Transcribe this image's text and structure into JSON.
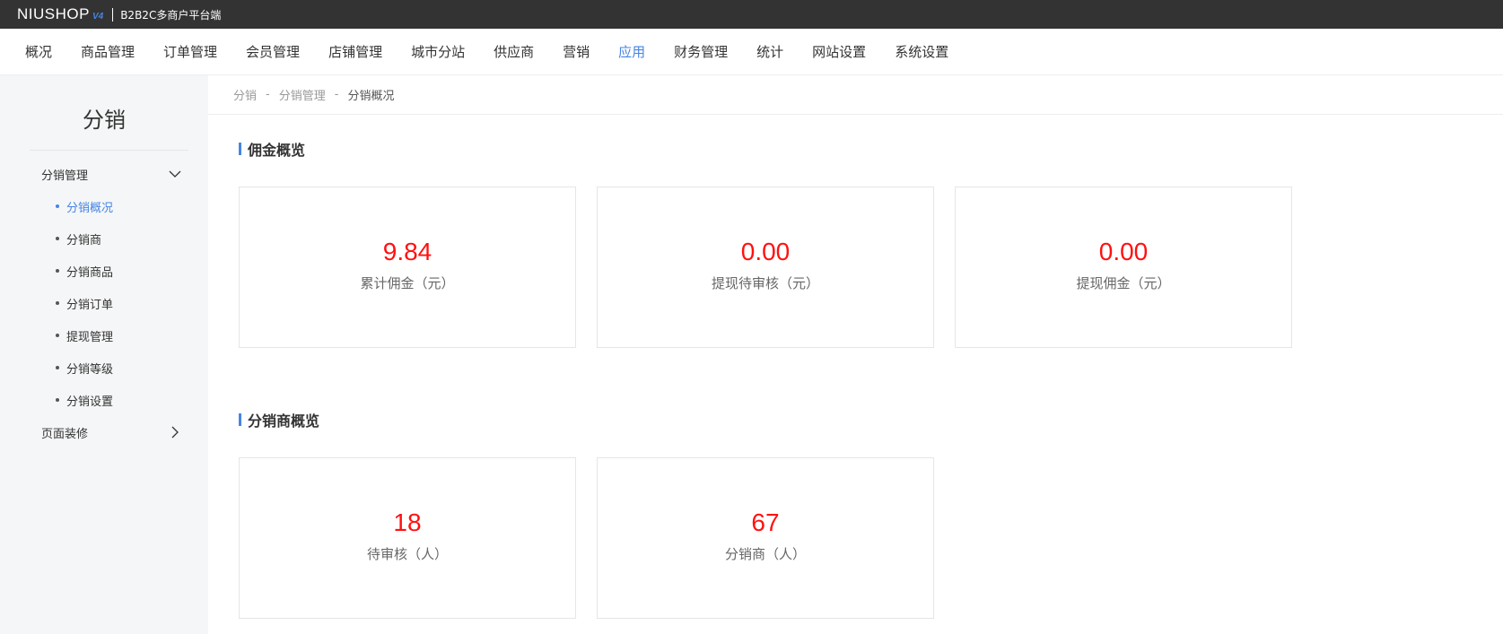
{
  "topbar": {
    "logo_text": "NIUSHOP",
    "logo_version": "V4",
    "platform_label": "B2B2C多商户平台端"
  },
  "nav": {
    "items": [
      {
        "label": "概况"
      },
      {
        "label": "商品管理"
      },
      {
        "label": "订单管理"
      },
      {
        "label": "会员管理"
      },
      {
        "label": "店铺管理"
      },
      {
        "label": "城市分站"
      },
      {
        "label": "供应商"
      },
      {
        "label": "营销"
      },
      {
        "label": "应用",
        "active": true
      },
      {
        "label": "财务管理"
      },
      {
        "label": "统计"
      },
      {
        "label": "网站设置"
      },
      {
        "label": "系统设置"
      }
    ]
  },
  "sidebar": {
    "title": "分销",
    "group1": {
      "label": "分销管理",
      "items": [
        {
          "label": "分销概况",
          "active": true
        },
        {
          "label": "分销商"
        },
        {
          "label": "分销商品"
        },
        {
          "label": "分销订单"
        },
        {
          "label": "提现管理"
        },
        {
          "label": "分销等级"
        },
        {
          "label": "分销设置"
        }
      ]
    },
    "group2": {
      "label": "页面装修"
    }
  },
  "breadcrumb": {
    "items": [
      "分销",
      "分销管理",
      "分销概况"
    ],
    "separator": "-"
  },
  "commission": {
    "title": "佣金概览",
    "cards": [
      {
        "value": "9.84",
        "label": "累计佣金（元）"
      },
      {
        "value": "0.00",
        "label": "提现待审核（元）"
      },
      {
        "value": "0.00",
        "label": "提现佣金（元）"
      }
    ]
  },
  "distributors": {
    "title": "分销商概览",
    "cards": [
      {
        "value": "18",
        "label": "待审核（人）"
      },
      {
        "value": "67",
        "label": "分销商（人）"
      }
    ]
  },
  "colors": {
    "accent": "#4685e4",
    "value_red": "#ff1111",
    "topbar_bg": "#333333",
    "sidebar_bg": "#f5f6f7"
  }
}
